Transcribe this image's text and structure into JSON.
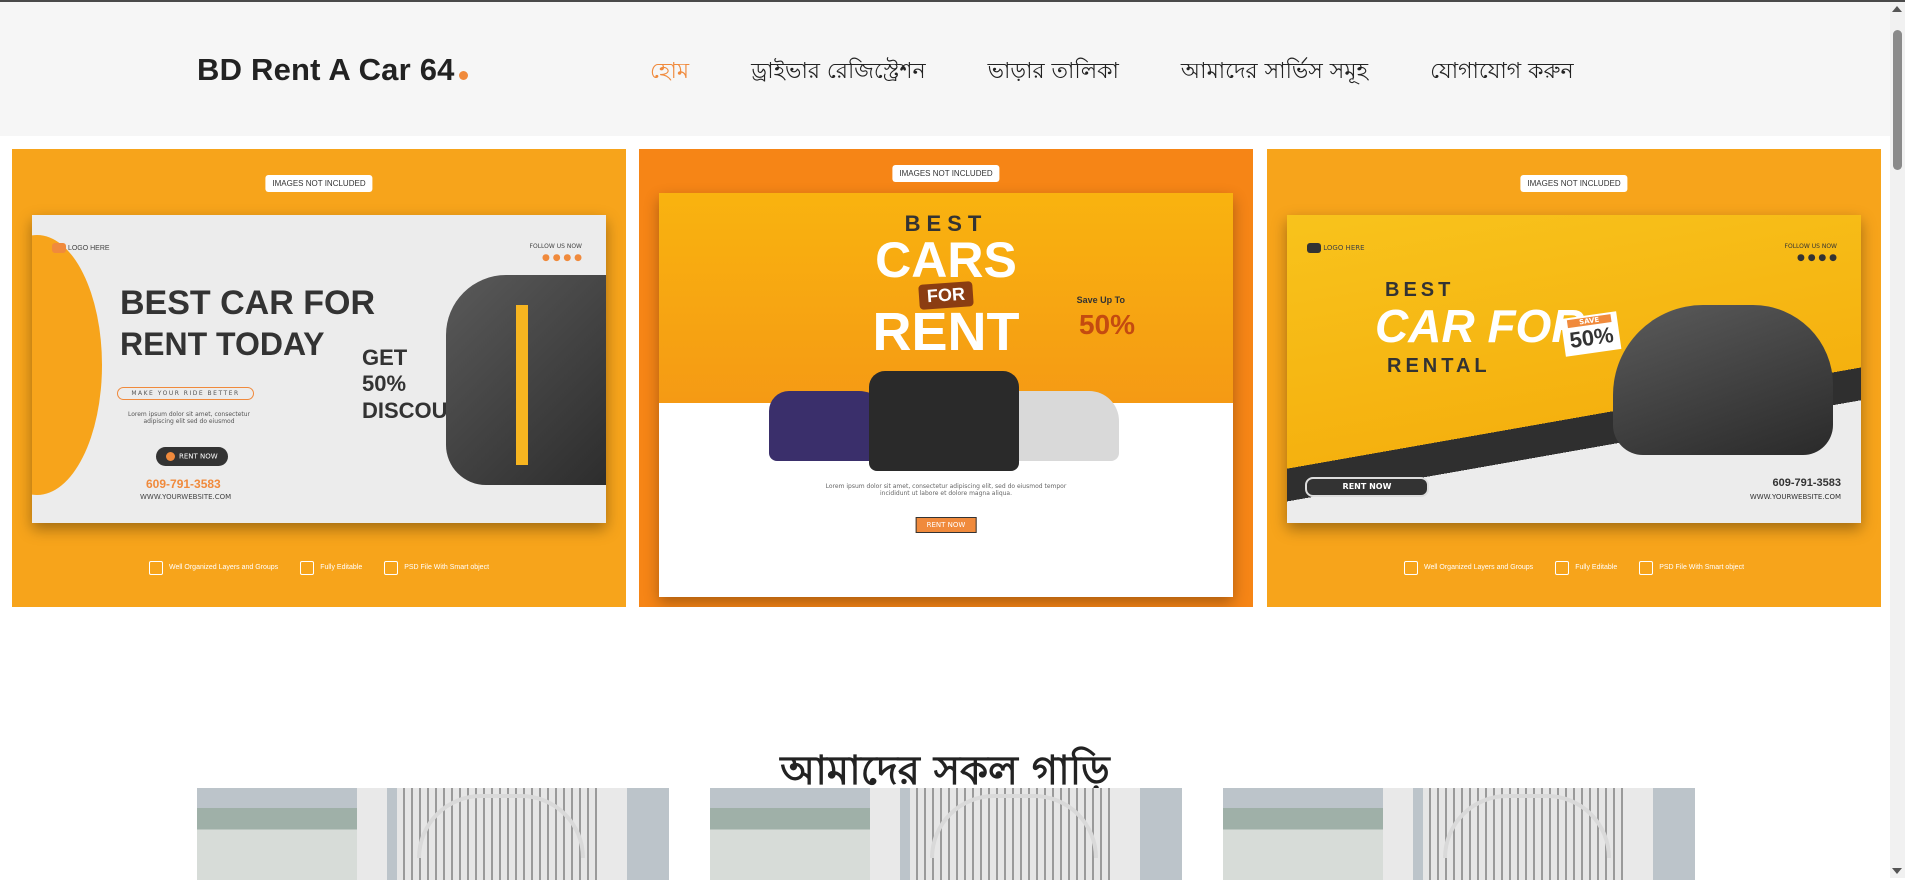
{
  "brand": {
    "name": "BD Rent A Car 64",
    "accent": "#f08a3c"
  },
  "nav": {
    "items": [
      {
        "label": "হোম",
        "active": true
      },
      {
        "label": "ড্রাইভার রেজিস্ট্রেশন",
        "active": false
      },
      {
        "label": "ভাড়ার তালিকা",
        "active": false
      },
      {
        "label": "আমাদের সার্ভিস সমূহ",
        "active": false
      },
      {
        "label": "যোগাযোগ করুন",
        "active": false
      }
    ]
  },
  "banners": [
    {
      "tag": "IMAGES NOT INCLUDED",
      "logo": "LOGO HERE",
      "follow": "FOLLOW US NOW",
      "line1": "BEST CAR FOR",
      "line2": "RENT TODAY",
      "ride": "MAKE YOUR RIDE BETTER",
      "lorem": "Lorem ipsum dolor sit amet, consectetur adipiscing elit sed do eiusmod",
      "offer": "GET 50% DISCOUNT",
      "cta": "RENT NOW",
      "phone": "609-791-3583",
      "site": "WWW.YOURWEBSITE.COM",
      "features": [
        "Well Organized Layers and Groups",
        "Fully Editable",
        "PSD File With Smart object"
      ]
    },
    {
      "tag": "IMAGES NOT INCLUDED",
      "line1": "BEST",
      "line2": "CARS",
      "line3": "FOR",
      "line4": "RENT",
      "save": "Save Up To",
      "pct": "50%",
      "lorem": "Lorem ipsum dolor sit amet, consectetur adipiscing elit, sed do eiusmod tempor incididunt ut labore et dolore magna aliqua.",
      "cta": "RENT NOW",
      "features": [
        "Well Organized Layers and Groups",
        "Fully Editable",
        "PSD File With Smart object"
      ]
    },
    {
      "tag": "IMAGES NOT INCLUDED",
      "logo": "LOGO HERE",
      "follow": "FOLLOW US NOW",
      "line1": "BEST",
      "line2": "CAR FOR",
      "line3": "RENTAL",
      "save": "SAVE",
      "pct": "50%",
      "cta": "RENT NOW",
      "phone": "609-791-3583",
      "site": "WWW.YOURWEBSITE.COM",
      "features": [
        "Well Organized Layers and Groups",
        "Fully Editable",
        "PSD File With Smart object"
      ]
    }
  ],
  "section": {
    "title": "আমাদের সকল গাড়ি"
  }
}
